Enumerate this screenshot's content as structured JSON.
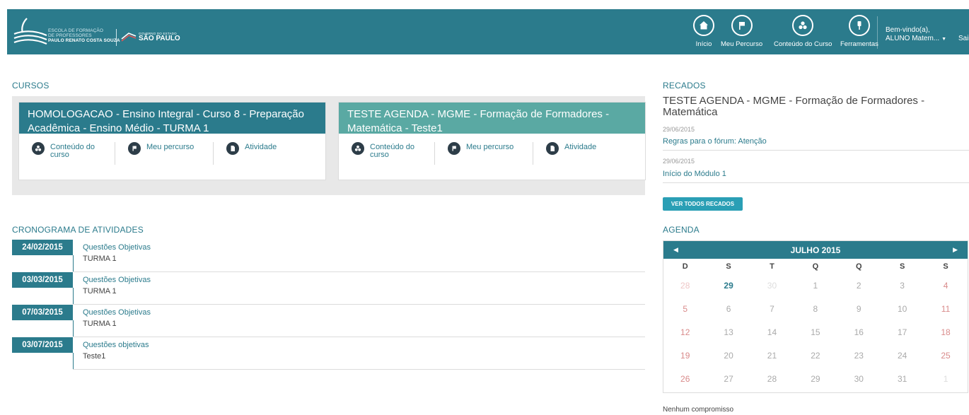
{
  "header": {
    "logo_lines": [
      "ESCOLA DE FORMAÇÃO",
      "DE PROFESSORES",
      "PAULO RENATO COSTA SOUZA"
    ],
    "gov_small": "GOVERNO DO ESTADO",
    "gov_big": "SÃO PAULO",
    "nav": [
      {
        "label": "Início",
        "icon": "home-icon"
      },
      {
        "label": "Meu Percurso",
        "icon": "flag-icon"
      },
      {
        "label": "Conteúdo do Curso",
        "icon": "content-icon"
      },
      {
        "label": "Ferramentas",
        "icon": "tools-icon"
      }
    ],
    "welcome_line1": "Bem-vindo(a),",
    "welcome_user": "ALUNO Matem...",
    "logout": "Sair"
  },
  "courses": {
    "title": "CURSOS",
    "items": [
      {
        "name": "HOMOLOGACAO - Ensino Integral - Curso 8 - Preparação Acadêmica - Ensino Médio - TURMA 1",
        "actions": [
          "Conteúdo do curso",
          "Meu percurso",
          "Atividade"
        ]
      },
      {
        "name": "TESTE AGENDA - MGME - Formação de Formadores - Matemática - Teste1",
        "actions": [
          "Conteúdo do curso",
          "Meu percurso",
          "Atividade"
        ]
      }
    ]
  },
  "schedule": {
    "title": "CRONOGRAMA DE ATIVIDADES",
    "items": [
      {
        "date": "24/02/2015",
        "title": "Questões Objetivas",
        "sub": "TURMA 1"
      },
      {
        "date": "03/03/2015",
        "title": "Questões Objetivas",
        "sub": "TURMA 1"
      },
      {
        "date": "07/03/2015",
        "title": "Questões Objetivas",
        "sub": "TURMA 1"
      },
      {
        "date": "03/07/2015",
        "title": "Questões objetivas",
        "sub": "Teste1"
      }
    ]
  },
  "notices": {
    "title": "RECADOS",
    "course": "TESTE AGENDA - MGME - Formação de Formadores - Matemática",
    "items": [
      {
        "date": "29/06/2015",
        "text": "Regras para o fórum: Atenção"
      },
      {
        "date": "29/06/2015",
        "text": "Início do Módulo 1"
      }
    ],
    "button": "VER TODOS RECADOS"
  },
  "agenda": {
    "title": "AGENDA",
    "month": "JULHO 2015",
    "weekdays": [
      "D",
      "S",
      "T",
      "Q",
      "Q",
      "S",
      "S"
    ],
    "days": [
      [
        "28",
        "29",
        "30",
        "1",
        "2",
        "3",
        "4"
      ],
      [
        "5",
        "6",
        "7",
        "8",
        "9",
        "10",
        "11"
      ],
      [
        "12",
        "13",
        "14",
        "15",
        "16",
        "17",
        "18"
      ],
      [
        "19",
        "20",
        "21",
        "22",
        "23",
        "24",
        "25"
      ],
      [
        "26",
        "27",
        "28",
        "29",
        "30",
        "31",
        "1"
      ]
    ],
    "empty_text": "Nenhum compromisso"
  },
  "colors": {
    "primary": "#2b7b8c",
    "secondary": "#5aa9a3",
    "button": "#2a9fb5"
  }
}
